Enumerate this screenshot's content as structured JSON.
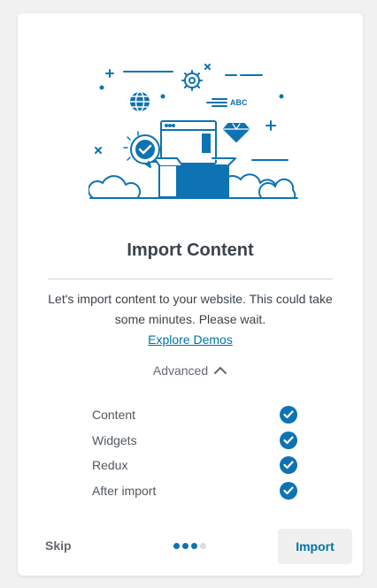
{
  "header": {
    "title": "Import Content",
    "description": "Let's import content to your website. This could take some minutes. Please wait.",
    "explore_link": "Explore Demos"
  },
  "illustration": {
    "accent_color": "#0e73b2",
    "badge_text": "ABC",
    "icons": [
      "gear-icon",
      "globe-icon",
      "diamond-icon",
      "checkmark-badge-icon",
      "browser-window-icon",
      "cloud-icon"
    ]
  },
  "advanced": {
    "label": "Advanced",
    "expanded": true
  },
  "options": [
    {
      "label": "Content",
      "checked": true
    },
    {
      "label": "Widgets",
      "checked": true
    },
    {
      "label": "Redux",
      "checked": true
    },
    {
      "label": "After import",
      "checked": true
    }
  ],
  "footer": {
    "skip_label": "Skip",
    "import_label": "Import",
    "steps_total": 4,
    "steps_current": 3
  },
  "colors": {
    "primary": "#0e73b2",
    "link": "#0073aa",
    "background": "#f1f1f1"
  }
}
